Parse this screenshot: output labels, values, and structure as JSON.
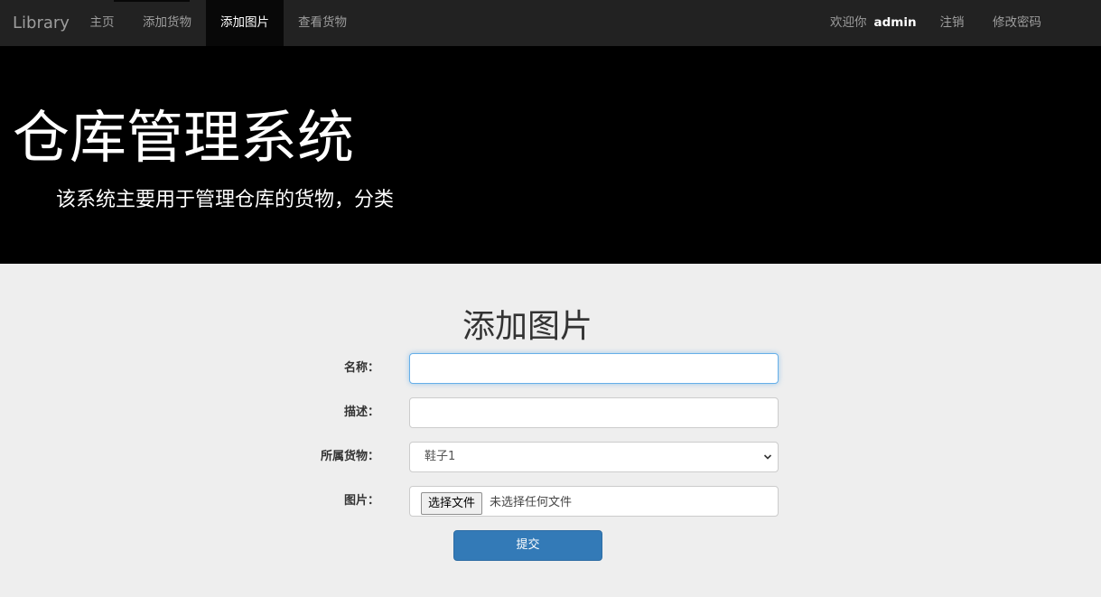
{
  "navbar": {
    "brand": "Library",
    "items": [
      {
        "label": "主页"
      },
      {
        "label": "添加货物"
      },
      {
        "label": "添加图片"
      },
      {
        "label": "查看货物"
      }
    ],
    "welcome_prefix": "欢迎你",
    "username": "admin",
    "logout": "注销",
    "change_password": "修改密码"
  },
  "jumbotron": {
    "title": "仓库管理系统",
    "subtitle": "该系统主要用于管理仓库的货物，分类"
  },
  "form": {
    "title": "添加图片",
    "name_label": "名称：",
    "name_value": "",
    "desc_label": "描述：",
    "desc_value": "",
    "goods_label": "所属货物：",
    "goods_selected": "鞋子1",
    "image_label": "图片：",
    "file_button": "选择文件",
    "file_status": "未选择任何文件",
    "submit": "提交"
  }
}
